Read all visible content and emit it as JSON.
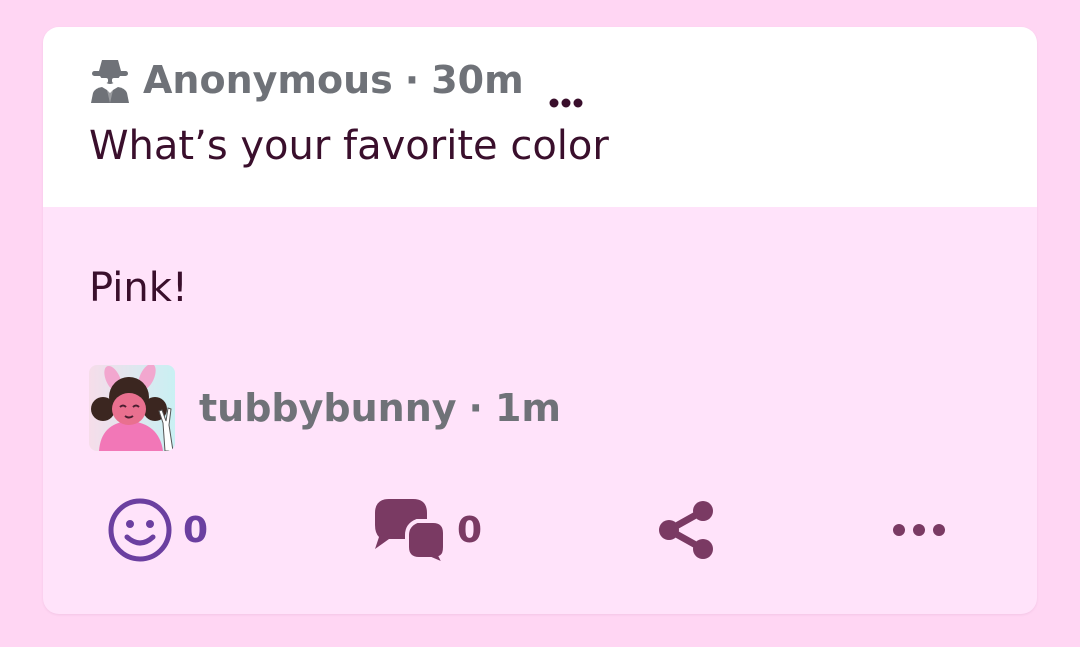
{
  "question": {
    "author": "Anonymous",
    "separator": "·",
    "time": "30m",
    "text": "What’s your favorite color",
    "icons": {
      "author": "spy-icon",
      "more": "more-horizontal-icon"
    }
  },
  "answer": {
    "text": "Pink!",
    "author": "tubbybunny",
    "separator": "·",
    "time": "1m"
  },
  "actions": {
    "reactions": {
      "icon": "smiley-icon",
      "count": "0"
    },
    "comments": {
      "icon": "speech-bubbles-icon",
      "count": "0"
    },
    "share": {
      "icon": "share-icon"
    },
    "more": {
      "icon": "more-horizontal-icon"
    }
  },
  "colors": {
    "page_background": "#ffd6f3",
    "card_background": "#ffe3fa",
    "question_background": "#ffffff",
    "text_primary": "#3a0f2c",
    "meta_gray": "#6f7278",
    "react_purple": "#6b3fa0",
    "action_plum": "#7a3a63"
  }
}
